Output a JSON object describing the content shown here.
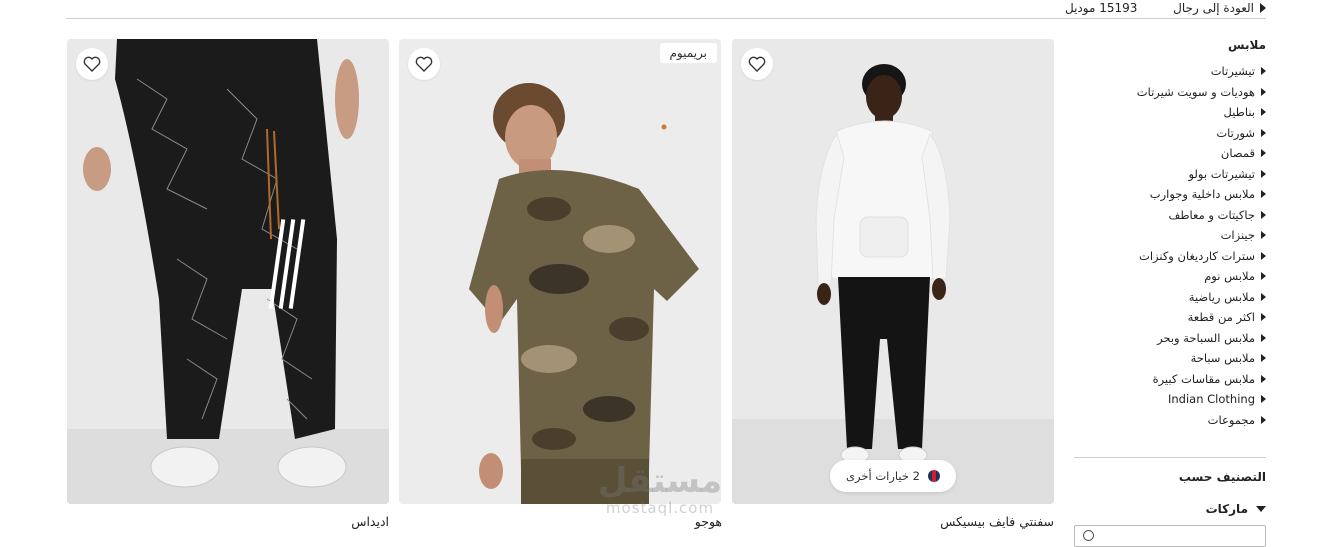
{
  "topbar": {
    "back_label": "العودة إلى رجال",
    "count_label": "15193 موديل"
  },
  "sidebar": {
    "category_heading": "ملابس",
    "categories": [
      "تيشيرتات",
      "هوديات و سويت شيرتات",
      "بناطيل",
      "شورتات",
      "قمصان",
      "تيشيرتات بولو",
      "ملابس داخلية وجوارب",
      "جاكيتات و معاطف",
      "جينزات",
      "سترات كارديغان وكنزات",
      "ملابس نوم",
      "ملابس رياضية",
      "اكثر من قطعة",
      "ملابس السباحة وبحر",
      "ملابس سباحة",
      "ملابس مقاسات كبيرة",
      "Indian Clothing",
      "مجموعات"
    ],
    "sort_heading": "التصنيف حسب",
    "brands_heading": "ماركات"
  },
  "products": [
    {
      "brand": "سفنتي فايف بيسيكس",
      "options_label": "2 خيارات أخرى",
      "badge": ""
    },
    {
      "brand": "هوجو",
      "badge": "بريميوم",
      "options_label": ""
    },
    {
      "brand": "اديداس",
      "badge": "",
      "options_label": ""
    }
  ],
  "watermark": {
    "arabic": "مستقل",
    "latin": "mostaql.com"
  },
  "colors": {
    "card_bg": "#e9e9ea",
    "text": "#222222",
    "divider": "#cfcfcf"
  },
  "icons": {
    "wishlist": "heart-icon",
    "nav_marker": "triangle-left-icon",
    "expand": "chevron-down-icon",
    "search": "search-icon"
  }
}
